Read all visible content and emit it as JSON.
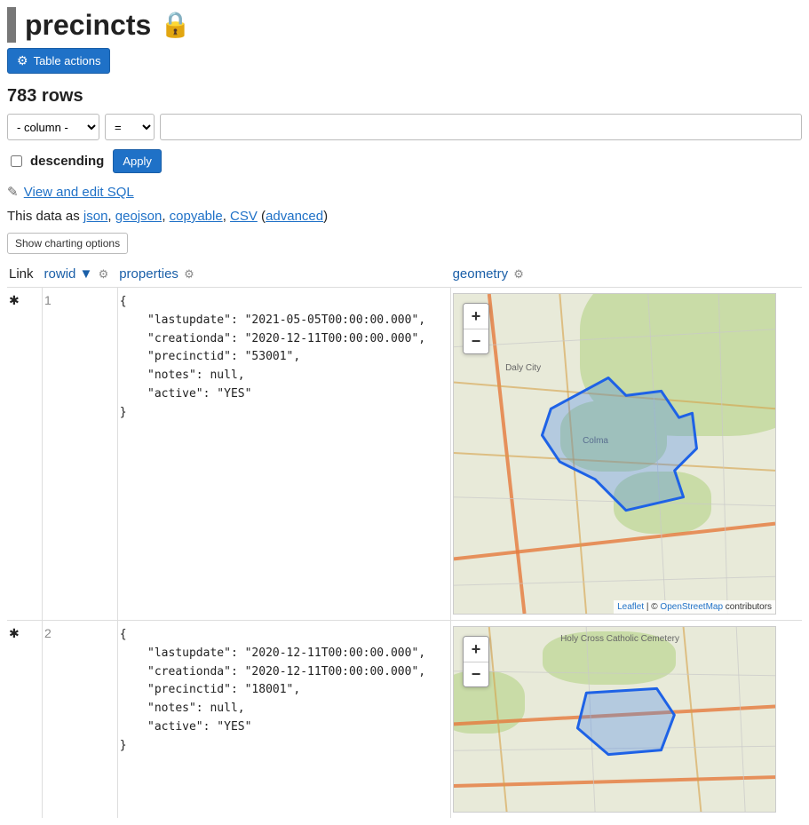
{
  "title": "precincts",
  "table_actions_label": "Table actions",
  "row_count_label": "783 rows",
  "filter": {
    "column_placeholder": "- column -",
    "operator": "=",
    "value": ""
  },
  "descending_label": "descending",
  "apply_label": "Apply",
  "sql_link_text": "View and edit SQL",
  "formats": {
    "prefix": "This data as ",
    "json": "json",
    "geojson": "geojson",
    "copyable": "copyable",
    "csv": "CSV",
    "advanced": "advanced"
  },
  "chart_button": "Show charting options",
  "columns": {
    "link": "Link",
    "rowid": "rowid ▼",
    "properties": "properties",
    "geometry": "geometry"
  },
  "rows": [
    {
      "rowid": "1",
      "properties_text": "{\n    \"lastupdate\": \"2021-05-05T00:00:00.000\",\n    \"creationda\": \"2020-12-11T00:00:00.000\",\n    \"precinctid\": \"53001\",\n    \"notes\": null,\n    \"active\": \"YES\"\n}",
      "map_labels": [
        "Daly City",
        "Colma"
      ]
    },
    {
      "rowid": "2",
      "properties_text": "{\n    \"lastupdate\": \"2020-12-11T00:00:00.000\",\n    \"creationda\": \"2020-12-11T00:00:00.000\",\n    \"precinctid\": \"18001\",\n    \"notes\": null,\n    \"active\": \"YES\"\n}",
      "map_labels": [
        "Holy Cross Catholic Cemetery"
      ]
    }
  ],
  "attribution": {
    "leaflet": "Leaflet",
    "sep": " | © ",
    "osm": "OpenStreetMap",
    "tail": " contributors"
  },
  "zoom": {
    "in": "+",
    "out": "−"
  }
}
